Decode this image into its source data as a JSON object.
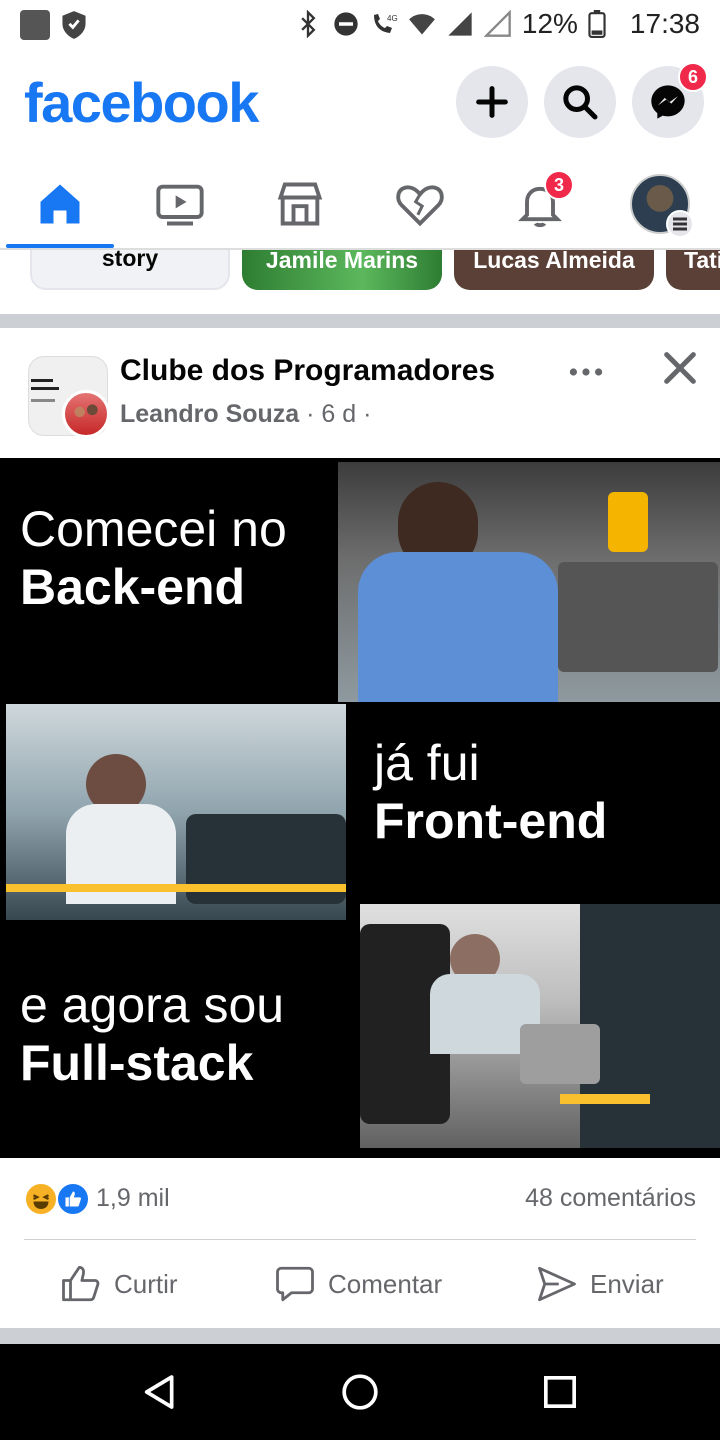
{
  "status_bar": {
    "battery": "12%",
    "time": "17:38",
    "network": "4G"
  },
  "header": {
    "logo": "facebook",
    "messenger_badge": "6",
    "icons": [
      "plus-icon",
      "search-icon",
      "messenger-icon"
    ]
  },
  "nav": {
    "tabs": [
      "home",
      "watch",
      "marketplace",
      "dating",
      "notifications",
      "profile-menu"
    ],
    "notifications_badge": "3",
    "active": "home"
  },
  "stories": [
    {
      "label": "story"
    },
    {
      "label": "Jamile Marins"
    },
    {
      "label": "Lucas Almeida"
    },
    {
      "label": "Tati"
    }
  ],
  "post": {
    "group_name": "Clube dos Programadores",
    "author": "Leandro Souza",
    "time": "6 d",
    "meta_sep1": " · ",
    "meta_sep2": " ·",
    "meme": {
      "line1a": "Comecei no",
      "line1b": "Back-end",
      "line2a": "já fui",
      "line2b": "Front-end",
      "line3a": "e agora sou",
      "line3b": "Full-stack"
    },
    "reactions_count": "1,9 mil",
    "comments": "48 comentários",
    "actions": {
      "like": "Curtir",
      "comment": "Comentar",
      "share": "Enviar"
    }
  },
  "colors": {
    "brand": "#1877f2",
    "badge": "#f02849",
    "secondary_text": "#65676b",
    "separator": "#ccd0d5"
  }
}
